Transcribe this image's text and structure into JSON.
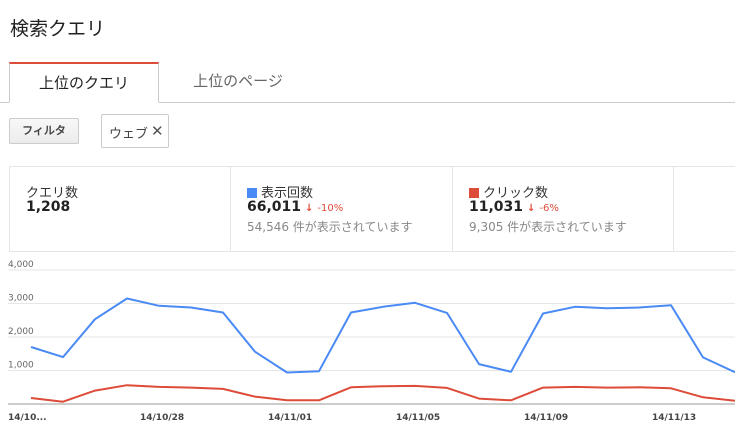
{
  "page": {
    "title": "検索クエリ"
  },
  "tabs": [
    {
      "label": "上位のクエリ",
      "active": true
    },
    {
      "label": "上位のページ",
      "active": false
    }
  ],
  "filter": {
    "button_label": "フィルタ",
    "chip_label": "ウェブ",
    "chip_close": "✕"
  },
  "stats": {
    "queries": {
      "label": "クエリ数",
      "value": "1,208"
    },
    "impressions": {
      "label": "表示回数",
      "value": "66,011",
      "delta_arrow": "↓",
      "delta": "-10%",
      "sub": "54,546 件が表示されています",
      "color": "#4a8af4"
    },
    "clicks": {
      "label": "クリック数",
      "value": "11,031",
      "delta_arrow": "↓",
      "delta": "-6%",
      "sub": "9,305 件が表示されています",
      "color": "#dd4b39"
    }
  },
  "chart_data": {
    "type": "line",
    "x": [
      "14/10/24",
      "14/10/25",
      "14/10/26",
      "14/10/27",
      "14/10/28",
      "14/10/29",
      "14/10/30",
      "14/10/31",
      "14/11/01",
      "14/11/02",
      "14/11/03",
      "14/11/04",
      "14/11/05",
      "14/11/06",
      "14/11/07",
      "14/11/08",
      "14/11/09",
      "14/11/10",
      "14/11/11",
      "14/11/12",
      "14/11/13",
      "14/11/14",
      "14/11/15"
    ],
    "x_tick_labels": [
      "14/10...",
      "14/10/28",
      "14/11/01",
      "14/11/05",
      "14/11/09",
      "14/11/13"
    ],
    "x_tick_indices": [
      0,
      4,
      8,
      12,
      16,
      20
    ],
    "y_ticks": [
      "1,000",
      "2,000",
      "3,000",
      "4,000"
    ],
    "ylim": [
      0,
      4000
    ],
    "series": [
      {
        "name": "表示回数",
        "color": "#4a8af4",
        "values": [
          1700,
          1400,
          2530,
          3150,
          2930,
          2880,
          2730,
          1560,
          940,
          980,
          2730,
          2900,
          3020,
          2720,
          1190,
          960,
          2700,
          2900,
          2860,
          2880,
          2950,
          1390,
          950
        ]
      },
      {
        "name": "クリック数",
        "color": "#dd4b39",
        "values": [
          180,
          70,
          400,
          560,
          510,
          490,
          450,
          220,
          110,
          110,
          500,
          530,
          540,
          480,
          160,
          110,
          490,
          510,
          490,
          500,
          470,
          200,
          100
        ]
      }
    ],
    "grid": true
  }
}
